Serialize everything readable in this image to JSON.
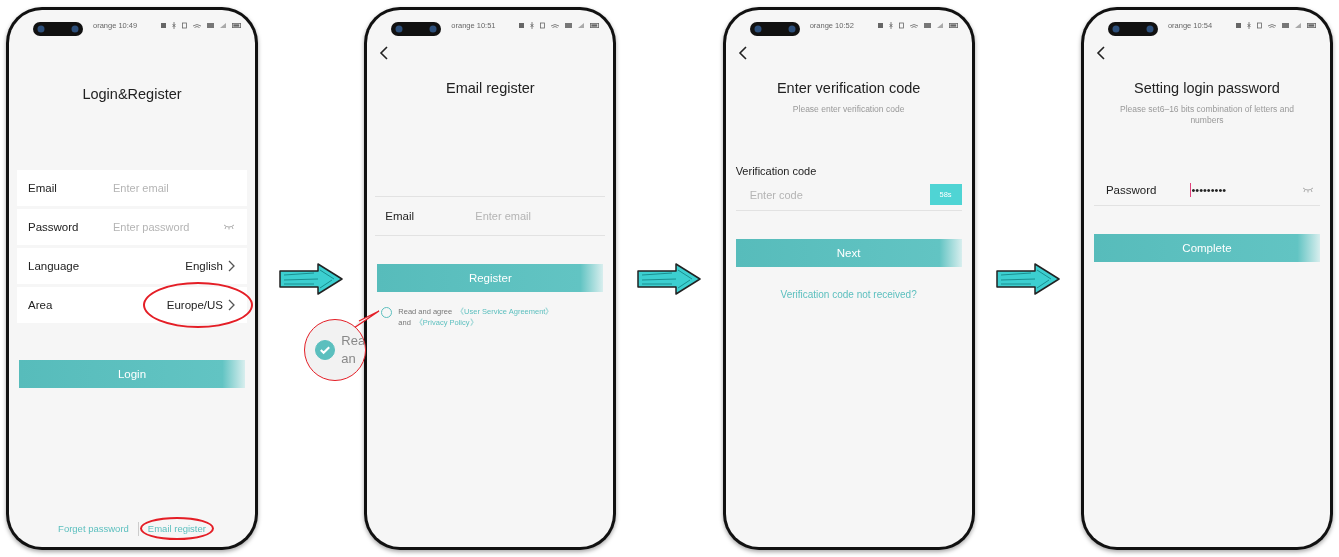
{
  "screens": [
    {
      "kind": "login",
      "time": "orange 10:49",
      "title": "Login&Register",
      "fields": [
        {
          "label": "Email",
          "placeholder": "Enter email",
          "eye": false
        },
        {
          "label": "Password",
          "placeholder": "Enter password",
          "eye": true
        }
      ],
      "settings": [
        {
          "label": "Language",
          "value": "English",
          "highlighted": false
        },
        {
          "label": "Area",
          "value": "Europe/US",
          "highlighted": true
        }
      ],
      "button": "Login",
      "links": [
        {
          "text": "Forget password",
          "highlighted": false
        },
        {
          "text": "Email register",
          "highlighted": true
        }
      ]
    },
    {
      "kind": "email",
      "time": "orange 10:51",
      "title": "Email register",
      "fields": [
        {
          "label": "Email",
          "placeholder": "Enter email",
          "eye": false
        }
      ],
      "button": "Register",
      "agreement": {
        "checked": false,
        "text": "Read and agree",
        "link1": "《User Service Agreement》",
        "joiner": "and",
        "link2": "《Privacy Policy》"
      },
      "magnifier": {
        "checked": true,
        "line1": "Rea",
        "line2": "an"
      }
    },
    {
      "kind": "code",
      "time": "orange 10:52",
      "title": "Enter verification code",
      "subtitle": "Please enter verification code",
      "field_label": "Verification code",
      "placeholder": "Enter code",
      "countdown": "58s",
      "button": "Next",
      "link": "Verification code not received?"
    },
    {
      "kind": "password",
      "time": "orange 10:54",
      "title": "Setting login password",
      "subtitle": "Please set6–16 bits combination of letters and numbers",
      "field_label": "Password",
      "value": "•••••••••",
      "button": "Complete"
    }
  ]
}
